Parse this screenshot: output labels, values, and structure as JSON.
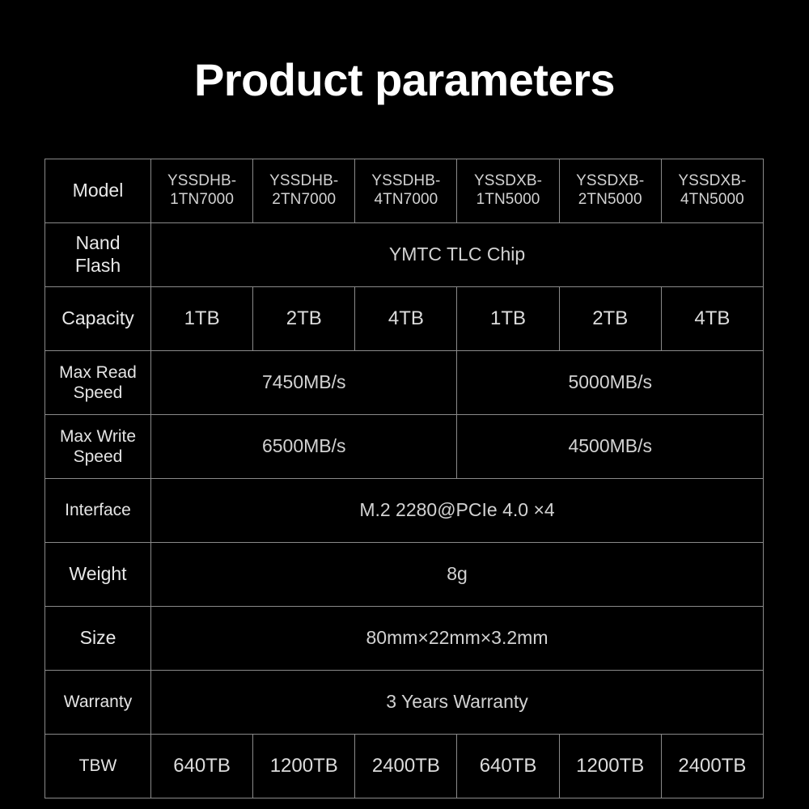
{
  "header": {
    "title": "Product parameters"
  },
  "table": {
    "rows": [
      {
        "id": "model",
        "label": "Model",
        "cells": [
          "YSSDHB-\n1TN7000",
          "YSSDHB-\n2TN7000",
          "YSSDHB-\n4TN7000",
          "YSSDXB-\n1TN5000",
          "YSSDXB-\n2TN5000",
          "YSSDXB-\n4TN5000"
        ]
      },
      {
        "id": "nand-flash",
        "label": "Nand\nFlash",
        "cells": [
          "YMTC TLC Chip"
        ]
      },
      {
        "id": "capacity",
        "label": "Capacity",
        "cells": [
          "1TB",
          "2TB",
          "4TB",
          "1TB",
          "2TB",
          "4TB"
        ]
      },
      {
        "id": "max-read-speed",
        "label": "Max Read\nSpeed",
        "cells": [
          "7450MB/s",
          "5000MB/s"
        ]
      },
      {
        "id": "max-write-speed",
        "label": "Max Write\nSpeed",
        "cells": [
          "6500MB/s",
          "4500MB/s"
        ]
      },
      {
        "id": "interface",
        "label": "Interface",
        "cells": [
          "M.2 2280@PCIe 4.0 ×4"
        ]
      },
      {
        "id": "weight",
        "label": "Weight",
        "cells": [
          "8g"
        ]
      },
      {
        "id": "size",
        "label": "Size",
        "cells": [
          "80mm×22mm×3.2mm"
        ]
      },
      {
        "id": "warranty",
        "label": "Warranty",
        "cells": [
          "3 Years Warranty"
        ]
      },
      {
        "id": "tbw",
        "label": "TBW",
        "cells": [
          "640TB",
          "1200TB",
          "2400TB",
          "640TB",
          "1200TB",
          "2400TB"
        ]
      }
    ]
  },
  "colors": {
    "background": "#000000",
    "title_text": "#ffffff",
    "body_text": "#d2d2d2",
    "border": "#8a8a8a"
  }
}
